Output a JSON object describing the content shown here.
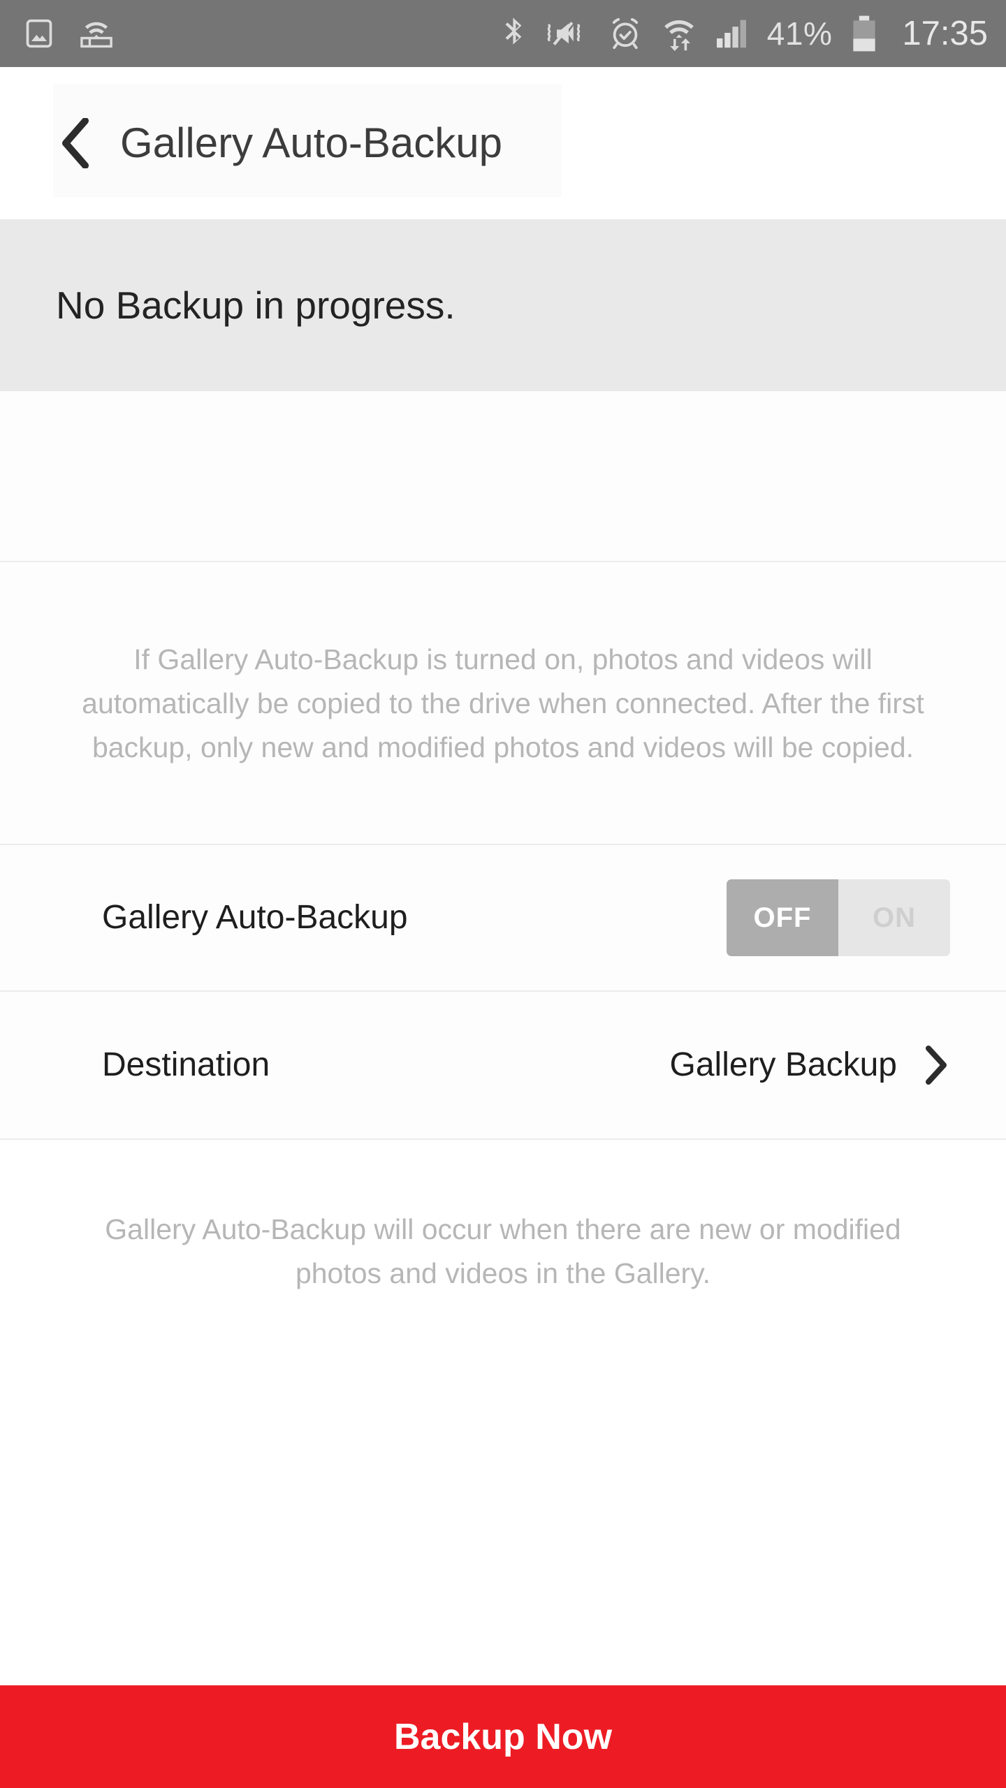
{
  "status_bar": {
    "background_color": "#757575",
    "left_icons": [
      {
        "name": "photo-image-icon",
        "label": "Image"
      },
      {
        "name": "wifi-router-icon",
        "label": "Wi-Fi Direct"
      }
    ],
    "right_icons": [
      {
        "name": "bluetooth-icon",
        "label": "Bluetooth"
      },
      {
        "name": "vibrate-mute-icon",
        "label": "Sound off / vibrate"
      },
      {
        "name": "alarm-clock-icon",
        "label": "Alarm set"
      },
      {
        "name": "wifi-transfer-icon",
        "label": "Wi-Fi data transfer"
      },
      {
        "name": "cellular-signal-icon",
        "label": "Mobile signal"
      }
    ],
    "battery_percent": "41%",
    "battery_level": 41,
    "time": "17:35"
  },
  "header": {
    "back_icon": "chevron-left-icon",
    "title": "Gallery Auto-Backup"
  },
  "status_banner": {
    "text": "No Backup in progress.",
    "background_color": "#e9e9e9"
  },
  "description": {
    "text": "If Gallery Auto-Backup is turned on, photos and videos will automatically be copied to the drive when connected. After the first backup, only new and modified photos and videos will be copied."
  },
  "settings": {
    "auto_backup": {
      "label": "Gallery Auto-Backup",
      "toggle": {
        "off_label": "OFF",
        "on_label": "ON",
        "selected": "OFF"
      }
    },
    "destination": {
      "label": "Destination",
      "value": "Gallery Backup",
      "chevron_icon": "chevron-right-icon"
    }
  },
  "footer_note": {
    "text": "Gallery Auto-Backup will occur when there are new or modified photos and videos in the Gallery."
  },
  "bottom_button": {
    "label": "Backup Now",
    "background_color": "#ed1c24",
    "text_color": "#ffffff"
  }
}
